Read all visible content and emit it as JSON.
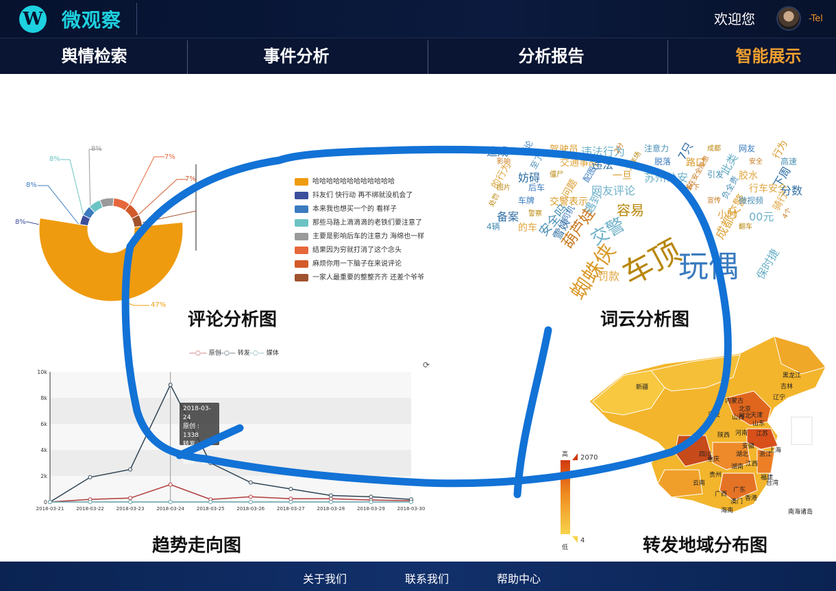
{
  "app": {
    "title": "微观察",
    "logo_glyph": "W"
  },
  "user": {
    "welcome": "欢迎您",
    "name": "-Tel"
  },
  "nav": {
    "items": [
      {
        "label": "舆情检索"
      },
      {
        "label": "事件分析"
      },
      {
        "label": "分析报告"
      },
      {
        "label": "智能展示",
        "active": true
      }
    ]
  },
  "sections": {
    "comment": "评论分析图",
    "wordcloud": "词云分析图",
    "trend": "趋势走向图",
    "geo": "转发地域分布图"
  },
  "pie": {
    "percent_labels": [
      "8%",
      "8%",
      "8%",
      "8%",
      "7%",
      "7%",
      "47%"
    ],
    "legend": [
      {
        "label": "哈哈哈哈哈哈哈哈哈哈哈哈",
        "color": "#ef9b0f"
      },
      {
        "label": "抖友们 快行动 再不绑就没机会了",
        "color": "#3d4f9b"
      },
      {
        "label": "本来我也想买一个的 看样子",
        "color": "#3b7bbf"
      },
      {
        "label": "那些马路上滴滴滴的老铁们要注意了",
        "color": "#6cc3c3"
      },
      {
        "label": "主要是影响后车的注意力 海绵也一样",
        "color": "#9a9a9a"
      },
      {
        "label": "结果因为穷就打消了这个念头",
        "color": "#e7673c"
      },
      {
        "label": "麻烦你用一下脑子在来说评论",
        "color": "#d35a2a"
      },
      {
        "label": "一家人最重要的整整齐齐 还差个爷爷",
        "color": "#a0522d"
      }
    ]
  },
  "wordcloud": {
    "words": [
      "车顶",
      "玩偶",
      "蜘蛛侠",
      "交警",
      "葫芦娃",
      "安全吗",
      "成都交警",
      "造成",
      "容易",
      "评论",
      "驾驶员",
      "违法行为",
      "2分",
      "注意力",
      "罚款",
      "7只",
      "成都",
      "网友",
      "行为",
      "保时捷",
      "影响",
      "至了",
      "交通事故",
      "违法",
      "万年场",
      "脱落",
      "路口",
      "此类",
      "安全",
      "高速",
      "的行为",
      "妨碍",
      "僵尸",
      "配图",
      "一旦",
      "苏州公安",
      "存在安全隐患",
      "引发",
      "胶水",
      "下周",
      "图片",
      "后车",
      "问题",
      "网友评论",
      "掉下",
      "负全责",
      "行车安全",
      "分数",
      "处罚",
      "车牌",
      "交警表示",
      "遇到",
      "宣传",
      "微视频",
      "骑行",
      "备案",
      "警察",
      "司机",
      "小时",
      "00元",
      "4个",
      "4辆",
      "的车",
      "雪姨",
      "翻车"
    ]
  },
  "chart_data": {
    "type": "line",
    "legend": [
      "原创",
      "转发",
      "媒体"
    ],
    "x": [
      "2018-03-21",
      "2018-03-22",
      "2018-03-23",
      "2018-03-24",
      "2018-03-25",
      "2018-03-26",
      "2018-03-27",
      "2018-03-28",
      "2018-03-29",
      "2018-03-30"
    ],
    "y_ticks": [
      "0",
      "2k",
      "4k",
      "6k",
      "8k",
      "10k"
    ],
    "ylim": [
      0,
      10000
    ],
    "series": [
      {
        "name": "原创",
        "color": "#b03a3a",
        "values": [
          0,
          200,
          300,
          1338,
          200,
          400,
          250,
          250,
          150,
          100
        ]
      },
      {
        "name": "转发",
        "color": "#2f4554",
        "values": [
          0,
          1900,
          2500,
          9009,
          3000,
          1500,
          1000,
          500,
          400,
          200
        ]
      },
      {
        "name": "媒体",
        "color": "#61a0a8",
        "values": [
          0,
          0,
          0,
          0,
          0,
          0,
          0,
          0,
          0,
          0
        ]
      }
    ],
    "tooltip": {
      "date": "2018-03-24",
      "line1": "原创 : 1338",
      "line2": "转发 : 9009",
      "line3": "媒体 : 144"
    }
  },
  "map": {
    "scale_high_label": "高",
    "scale_low_label": "低",
    "max_value": "2070",
    "min_value": "4",
    "provinces": [
      "新疆",
      "黑龙江",
      "吉林",
      "辽宁",
      "内蒙古",
      "北京",
      "天津",
      "河北",
      "山西",
      "山东",
      "宁夏",
      "陕西",
      "河南",
      "江苏",
      "安徽",
      "上海",
      "浙江",
      "四川",
      "重庆",
      "湖北",
      "湖南",
      "江西",
      "福建",
      "贵州",
      "云南",
      "广西",
      "广东",
      "台湾",
      "香港",
      "澳门",
      "海南",
      "南海诸岛"
    ]
  },
  "footer": {
    "links": [
      "关于我们",
      "联系我们",
      "帮助中心"
    ]
  }
}
